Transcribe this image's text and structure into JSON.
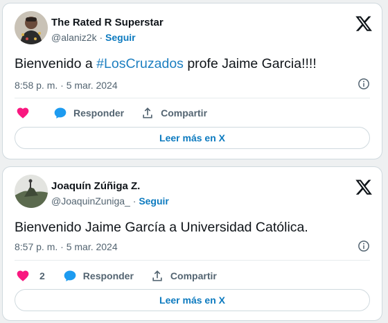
{
  "colors": {
    "accent": "#1d9bf0",
    "link": "#0c7abf",
    "like": "#f91880",
    "muted": "#536471",
    "text": "#0f1419",
    "border": "#cfd9de",
    "background": "#eef0f1"
  },
  "posts": [
    {
      "author_name": "The Rated R Superstar",
      "handle": "@alaniz2k",
      "separator": "·",
      "follow_label": "Seguir",
      "text_before": "Bienvenido a ",
      "hashtag": "#LosCruzados",
      "text_after": " profe Jaime Garcia!!!!",
      "timestamp": "8:58 p. m. · 5 mar. 2024",
      "like_count": "",
      "reply_label": "Responder",
      "share_label": "Compartir",
      "read_more_label": "Leer más en X",
      "icons": [
        "avatar-photo",
        "x-logo-icon",
        "info-icon",
        "heart-icon",
        "reply-bubble-icon",
        "share-icon"
      ]
    },
    {
      "author_name": "Joaquín Zúñiga Z.",
      "handle": "@JoaquinZuniga_",
      "separator": "·",
      "follow_label": "Seguir",
      "text": "Bienvenido Jaime García a Universidad Católica.",
      "timestamp": "8:57 p. m. · 5 mar. 2024",
      "like_count": "2",
      "reply_label": "Responder",
      "share_label": "Compartir",
      "read_more_label": "Leer más en X",
      "icons": [
        "avatar-photo",
        "x-logo-icon",
        "info-icon",
        "heart-icon",
        "reply-bubble-icon",
        "share-icon"
      ]
    }
  ]
}
